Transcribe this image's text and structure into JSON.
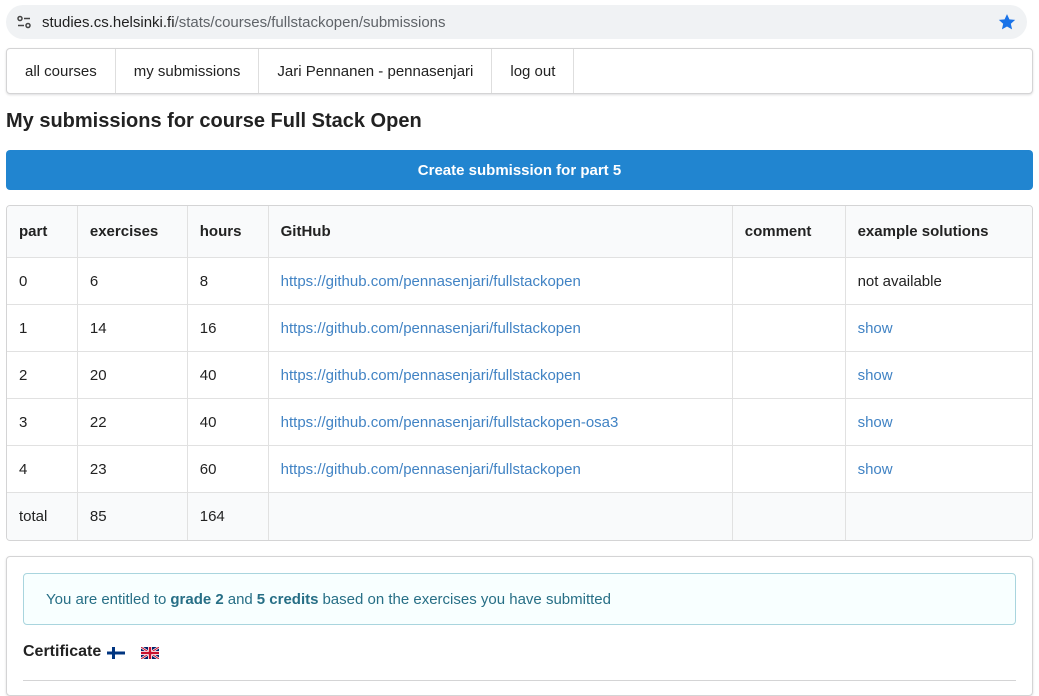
{
  "browser": {
    "url_host": "studies.cs.helsinki.fi",
    "url_path": "/stats/courses/fullstackopen/submissions",
    "star_color": "#1a73e8"
  },
  "menu": {
    "items": [
      {
        "label": "all courses"
      },
      {
        "label": "my submissions"
      },
      {
        "label": "Jari Pennanen - pennasenjari"
      },
      {
        "label": "log out"
      }
    ]
  },
  "page": {
    "title": "My submissions for course Full Stack Open",
    "create_button": "Create submission for part 5",
    "accent": "#2185d0"
  },
  "table": {
    "headers": [
      "part",
      "exercises",
      "hours",
      "GitHub",
      "comment",
      "example solutions"
    ],
    "rows": [
      {
        "part": "0",
        "exercises": "6",
        "hours": "8",
        "github": "https://github.com/pennasenjari/fullstackopen",
        "comment": "",
        "solutions": "not available",
        "solutions_link": false
      },
      {
        "part": "1",
        "exercises": "14",
        "hours": "16",
        "github": "https://github.com/pennasenjari/fullstackopen",
        "comment": "",
        "solutions": "show",
        "solutions_link": true
      },
      {
        "part": "2",
        "exercises": "20",
        "hours": "40",
        "github": "https://github.com/pennasenjari/fullstackopen",
        "comment": "",
        "solutions": "show",
        "solutions_link": true
      },
      {
        "part": "3",
        "exercises": "22",
        "hours": "40",
        "github": "https://github.com/pennasenjari/fullstackopen-osa3",
        "comment": "",
        "solutions": "show",
        "solutions_link": true
      },
      {
        "part": "4",
        "exercises": "23",
        "hours": "60",
        "github": "https://github.com/pennasenjari/fullstackopen",
        "comment": "",
        "solutions": "show",
        "solutions_link": true
      }
    ],
    "total": {
      "label": "total",
      "exercises": "85",
      "hours": "164"
    }
  },
  "grade_message": {
    "prefix": "You are entitled to",
    "grade": "grade 2",
    "and": "and",
    "credits": "5 credits",
    "suffix": "based on the exercises you have submitted"
  },
  "certificate": {
    "label": "Certificate",
    "flags": [
      "finland-flag-icon",
      "uk-flag-icon"
    ]
  }
}
